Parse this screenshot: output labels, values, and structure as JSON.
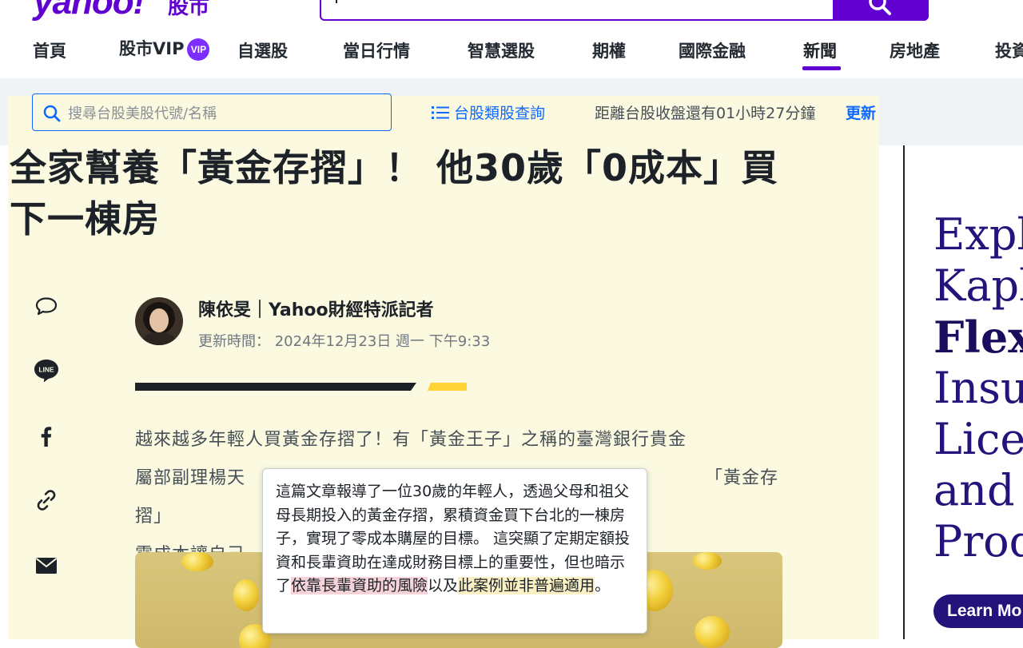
{
  "header": {
    "logo": "yahoo!",
    "logo_sub": "股市",
    "search_value": ""
  },
  "nav": {
    "items": [
      "首頁",
      "股市VIP",
      "自選股",
      "當日行情",
      "智慧選股",
      "期權",
      "國際金融",
      "新聞",
      "房地產",
      "投資"
    ],
    "vip_badge": "VIP",
    "active": "新聞"
  },
  "subbar": {
    "search_placeholder": "搜尋台股美股代號/名稱",
    "category_link": "台股類股查詢",
    "countdown": "距離台股收盤還有01小時27分鐘",
    "update": "更新"
  },
  "article": {
    "headline_line1": "全家幫養「黃金存摺」！ 他30歲「0成本」買",
    "headline_line2": "下一棟房",
    "author": "陳依旻｜Yahoo財經特派記者",
    "updated": "更新時間： 2024年12月23日 週一 下午9:33",
    "body_line1": "越來越多年輕人買黃金存摺了！有「黃金王子」之稱的臺灣銀行貴金",
    "body_line2_a": "屬部副理楊天",
    "body_line2_b": "「黃金存摺」",
    "body_line3_a": "零成本讓自己"
  },
  "tooltip": {
    "text_a": "這篇文章報導了一位30歲的年輕人，透過父母和祖父母長期投入的黃金存摺，累積資金買下台北的一棟房子，實現了零成本購屋的目標。 這突顯了定期定額投資和長輩資助在達成財務目標上的重要性，但也暗示了",
    "highlight_red": "依靠長輩資助的風險",
    "text_b": "以及",
    "highlight_yellow": "此案例並非普遍適用",
    "text_c": "。"
  },
  "ad": {
    "line1": "Expl",
    "line2": "Kapl",
    "line3": "Flex",
    "line4": "Insu",
    "line5": "Licer",
    "line6": "and",
    "line7": "Prod",
    "button": "Learn Mo"
  },
  "colors": {
    "brand": "#6001d2",
    "link": "#0f69ff",
    "highlight_bg": "#fbfae1",
    "ad_navy": "#23137a"
  },
  "icons": [
    "search-icon",
    "list-icon",
    "comment-icon",
    "line-icon",
    "facebook-icon",
    "link-icon",
    "mail-icon"
  ]
}
